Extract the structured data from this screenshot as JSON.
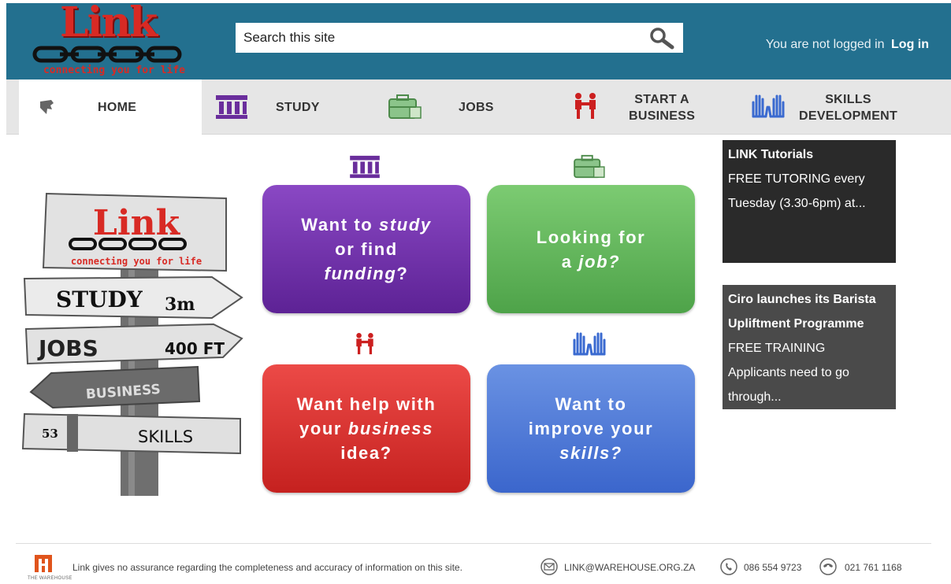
{
  "header": {
    "logo_text": "Link",
    "logo_tagline": "connecting you for life",
    "search_placeholder": "Search this site",
    "login_status": "You are not logged in",
    "login_link": "Log in"
  },
  "nav": {
    "items": [
      {
        "label": "HOME",
        "icon": "home-icon"
      },
      {
        "label": "STUDY",
        "icon": "building-icon"
      },
      {
        "label": "JOBS",
        "icon": "briefcase-icon"
      },
      {
        "label": "START A\nBUSINESS",
        "icon": "handshake-icon"
      },
      {
        "label": "SKILLS\nDEVELOPMENT",
        "icon": "hands-icon"
      }
    ]
  },
  "signpost": {
    "logo_text": "Link",
    "tagline": "connecting you for life",
    "signs": [
      "STUDY",
      "3m",
      "JOBS",
      "400 FT",
      "BUSINESS",
      "53",
      "SKILLS"
    ]
  },
  "tiles": {
    "study": {
      "pre": "Want to ",
      "em": "study",
      "mid": "or find",
      "em2": "funding",
      "post": "?"
    },
    "jobs": {
      "pre": "Looking for",
      "mid": "a ",
      "em": "job?"
    },
    "business": {
      "pre": "Want help with",
      "mid": "your ",
      "em": "business",
      "post": "idea?"
    },
    "skills": {
      "pre": "Want to",
      "mid": "improve your",
      "em": "skills?"
    }
  },
  "news": [
    {
      "title": "LINK Tutorials",
      "body": [
        "FREE TUTORING every",
        "Tuesday (3.30-6pm) at..."
      ]
    },
    {
      "title": "Ciro launches its Barista",
      "title2": "Upliftment Programme",
      "body": [
        "FREE TRAINING",
        "Applicants need to go",
        "through..."
      ]
    }
  ],
  "footer": {
    "org": "THE WAREHOUSE",
    "disclaimer": "Link gives no assurance regarding the completeness and accuracy of information on this site.",
    "email": "LINK@WAREHOUSE.ORG.ZA",
    "phone": "086 554 9723",
    "fax": "021 761 1168"
  },
  "colors": {
    "header": "#23708f",
    "study": "#6d2fab",
    "jobs": "#5cb356",
    "business": "#d92e2b",
    "skills": "#4a74d6",
    "logo_red": "#d82a24"
  }
}
